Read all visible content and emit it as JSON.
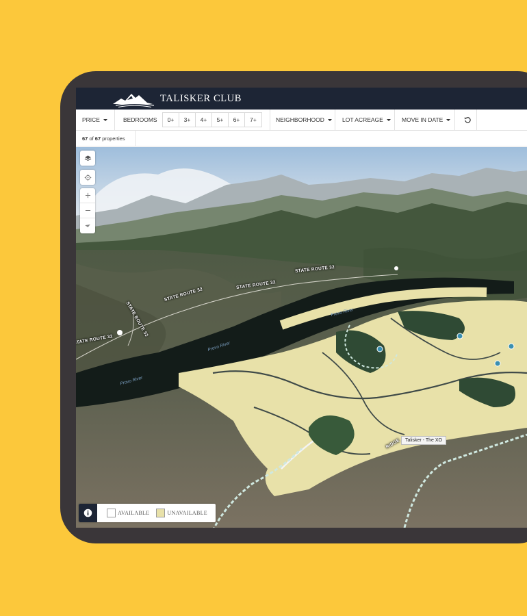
{
  "colors": {
    "background": "#FCC83B",
    "device_frame": "#3a3639",
    "header_bg": "#1d2535",
    "available_swatch": "#ffffff",
    "unavailable_swatch": "#e8e1a9",
    "lot_fill": "#e8e1a9",
    "marker": "#3a8fb0"
  },
  "header": {
    "brand": "TALISKER CLUB",
    "logo_icon": "mountain-logo-icon"
  },
  "filters": {
    "price": "PRICE",
    "bedrooms": "BEDROOMS",
    "bedroom_options": [
      "0+",
      "3+",
      "4+",
      "5+",
      "6+",
      "7+"
    ],
    "neighborhood": "NEIGHBORHOOD",
    "lot_acreage": "LOT ACREAGE",
    "move_in_date": "MOVE IN DATE",
    "reset_icon": "reset-icon"
  },
  "results": {
    "shown": "67",
    "of": "of",
    "total": "67",
    "suffix": "properties"
  },
  "map": {
    "controls": [
      "layers-icon",
      "locate-icon",
      "zoom-in-icon",
      "zoom-out-icon",
      "compass-icon"
    ],
    "road_labels": [
      "STATE ROUTE 32",
      "STATE ROUTE 32",
      "STATE ROUTE 32",
      "STATE ROUTE 32",
      "STATE ROUTE 32",
      "RIDGE"
    ],
    "river_labels": [
      "Provo River",
      "Provo River",
      "Provo River"
    ],
    "tooltip": "Talisker - The XO",
    "legend": {
      "info_icon": "info-icon",
      "available": "AVAILABLE",
      "unavailable": "UNAVAILABLE"
    }
  }
}
